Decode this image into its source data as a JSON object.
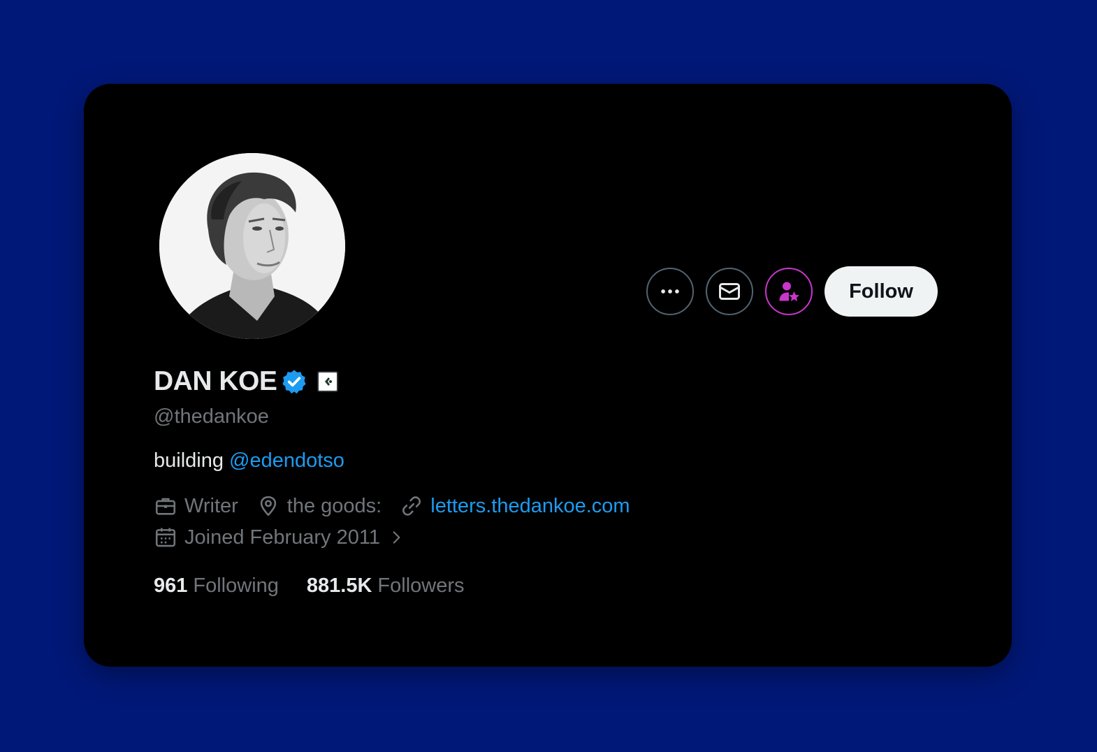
{
  "profile": {
    "display_name": "DAN KOE",
    "handle": "@thedankoe",
    "bio_text": "building ",
    "bio_mention": "@edendotso",
    "profession": "Writer",
    "location": "the goods:",
    "website": "letters.thedankoe.com",
    "joined": "Joined February 2011"
  },
  "stats": {
    "following_count": "961",
    "following_label": "Following",
    "followers_count": "881.5K",
    "followers_label": "Followers"
  },
  "actions": {
    "follow_label": "Follow"
  },
  "colors": {
    "background": "#001878",
    "card": "#000000",
    "link": "#1d9bf0",
    "verified": "#1d9bf0",
    "subscribe_accent": "#c936cc",
    "muted_text": "#71767b"
  },
  "icons": [
    "more-icon",
    "message-icon",
    "subscribe-icon",
    "verified-badge-icon",
    "affiliate-badge-icon",
    "briefcase-icon",
    "location-pin-icon",
    "link-icon",
    "calendar-icon",
    "chevron-right-icon"
  ]
}
